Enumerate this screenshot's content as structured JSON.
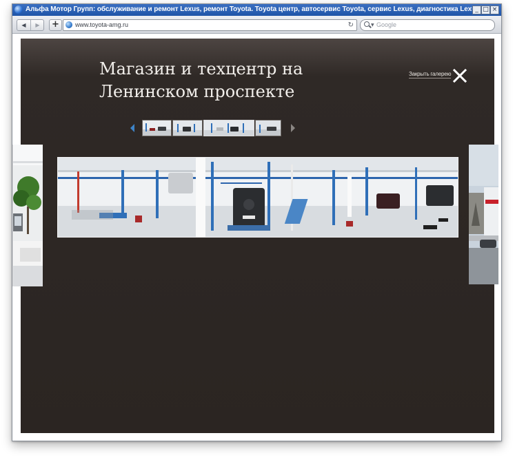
{
  "window": {
    "title": "Альфа Мотор Групп: обслуживание и ремонт Lexus, ремонт Toyota. Toyota центр, автосервис Toyota, сервис Lexus, диагностика Lexus.",
    "minimize_glyph": "_",
    "maximize_glyph": "□",
    "close_glyph": "×"
  },
  "toolbar": {
    "back_glyph": "◀",
    "forward_glyph": "▶",
    "new_tab_glyph": "+",
    "url": "www.toyota-amg.ru",
    "reload_glyph": "↻",
    "search_placeholder": "Google",
    "search_dropdown_glyph": "▼"
  },
  "gallery": {
    "title": "Магазин и техцентр на Ленинском проспекте",
    "close_label": "Закрыть галерею",
    "thumbnails": [
      {
        "name": "thumb-1",
        "active": false
      },
      {
        "name": "thumb-2",
        "active": false
      },
      {
        "name": "thumb-3",
        "active": true
      },
      {
        "name": "thumb-4",
        "active": false
      },
      {
        "name": "thumb-5",
        "active": false
      }
    ]
  },
  "colors": {
    "gallery_background": "#2b2522",
    "title_text": "#f2efeb",
    "active_arrow": "#3e84c8",
    "titlebar": "#1f55a8"
  },
  "icons": {
    "prev": "triangle-left-icon",
    "next": "triangle-right-icon",
    "close": "x-icon",
    "search": "magnifier-icon",
    "site": "globe-icon",
    "reload": "reload-icon"
  }
}
